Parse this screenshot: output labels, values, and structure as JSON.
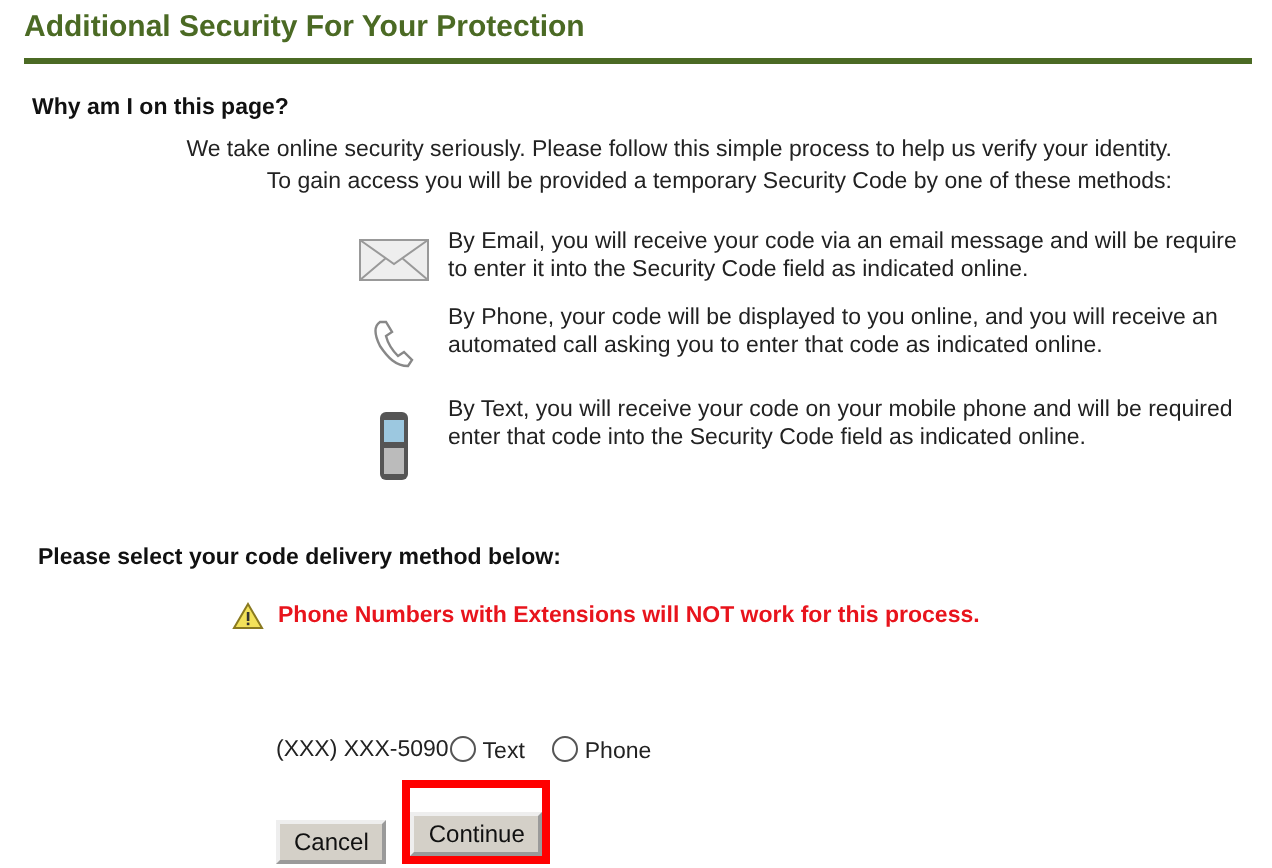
{
  "header": {
    "title": "Additional Security For Your Protection"
  },
  "intro": {
    "heading": "Why am I on this page?",
    "lines": [
      "We take online security seriously. Please follow this simple process to help us verify your identity.",
      "To gain access you will be provided a temporary Security Code by one of these methods:"
    ]
  },
  "methods": [
    {
      "kind": "email",
      "lines": [
        "By Email, you will receive your code via an email message and will be require",
        "to enter it into the Security Code field as indicated online."
      ]
    },
    {
      "kind": "phone",
      "lines": [
        "By Phone, your code will be displayed to you online, and you will receive an",
        "automated call asking you to enter that code as indicated online."
      ]
    },
    {
      "kind": "text",
      "lines": [
        "By Text, you will receive your code on your mobile phone and will be required",
        "enter that code into the Security Code field as indicated online."
      ]
    }
  ],
  "delivery": {
    "heading": "Please select your code delivery method below:",
    "warning": "Phone Numbers with Extensions will NOT work for this process.",
    "phone_number": "(XXX) XXX-5090",
    "options": [
      {
        "label": "Text",
        "selected": false
      },
      {
        "label": "Phone",
        "selected": false
      }
    ]
  },
  "buttons": [
    {
      "label": "Cancel",
      "highlighted": false
    },
    {
      "label": "Continue",
      "highlighted": true
    }
  ]
}
